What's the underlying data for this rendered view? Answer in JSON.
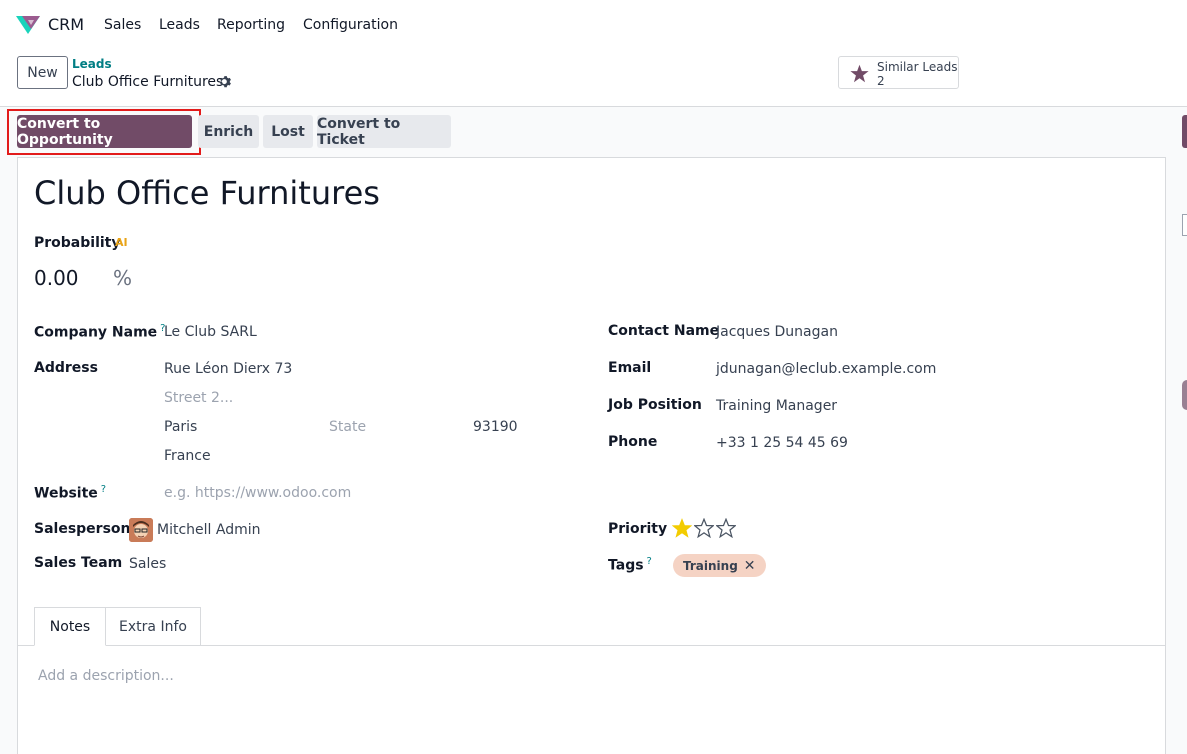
{
  "topbar": {
    "app_name": "CRM",
    "menu": [
      "Sales",
      "Leads",
      "Reporting",
      "Configuration"
    ]
  },
  "control_panel": {
    "new_label": "New",
    "breadcrumb_parent": "Leads",
    "breadcrumb_current": "Club Office Furnitures",
    "similar_leads_label": "Similar Leads",
    "similar_leads_count": "2"
  },
  "statusbar": {
    "convert_label": "Convert to Opportunity",
    "enrich_label": "Enrich",
    "lost_label": "Lost",
    "convert_ticket_label": "Convert to Ticket"
  },
  "form": {
    "title": "Club Office Furnitures",
    "probability_label": "Probability",
    "ai_badge": "AI",
    "probability_value": "0.00",
    "probability_unit": "%",
    "company_name_label": "Company Name",
    "company_name": "Le Club SARL",
    "address_label": "Address",
    "street": "Rue Léon Dierx 73",
    "street2_placeholder": "Street 2...",
    "city": "Paris",
    "state_placeholder": "State",
    "zip": "93190",
    "country": "France",
    "website_label": "Website",
    "website_placeholder": "e.g. https://www.odoo.com",
    "salesperson_label": "Salesperson",
    "salesperson": "Mitchell Admin",
    "sales_team_label": "Sales Team",
    "sales_team": "Sales",
    "contact_name_label": "Contact Name",
    "contact_name": "Jacques Dunagan",
    "email_label": "Email",
    "email": "jdunagan@leclub.example.com",
    "job_position_label": "Job Position",
    "job_position": "Training Manager",
    "phone_label": "Phone",
    "phone": "+33 1 25 54 45 69",
    "priority_label": "Priority",
    "priority_stars": 1,
    "priority_max": 3,
    "tags_label": "Tags",
    "tags": [
      "Training"
    ],
    "help_mark": "?"
  },
  "tabs": {
    "notes": "Notes",
    "extra_info": "Extra Info",
    "description_placeholder": "Add a description..."
  },
  "colors": {
    "primary": "#714b67",
    "highlight": "#e21b1b",
    "star": "#f3cc00",
    "tag_bg": "#f5d3c4"
  }
}
